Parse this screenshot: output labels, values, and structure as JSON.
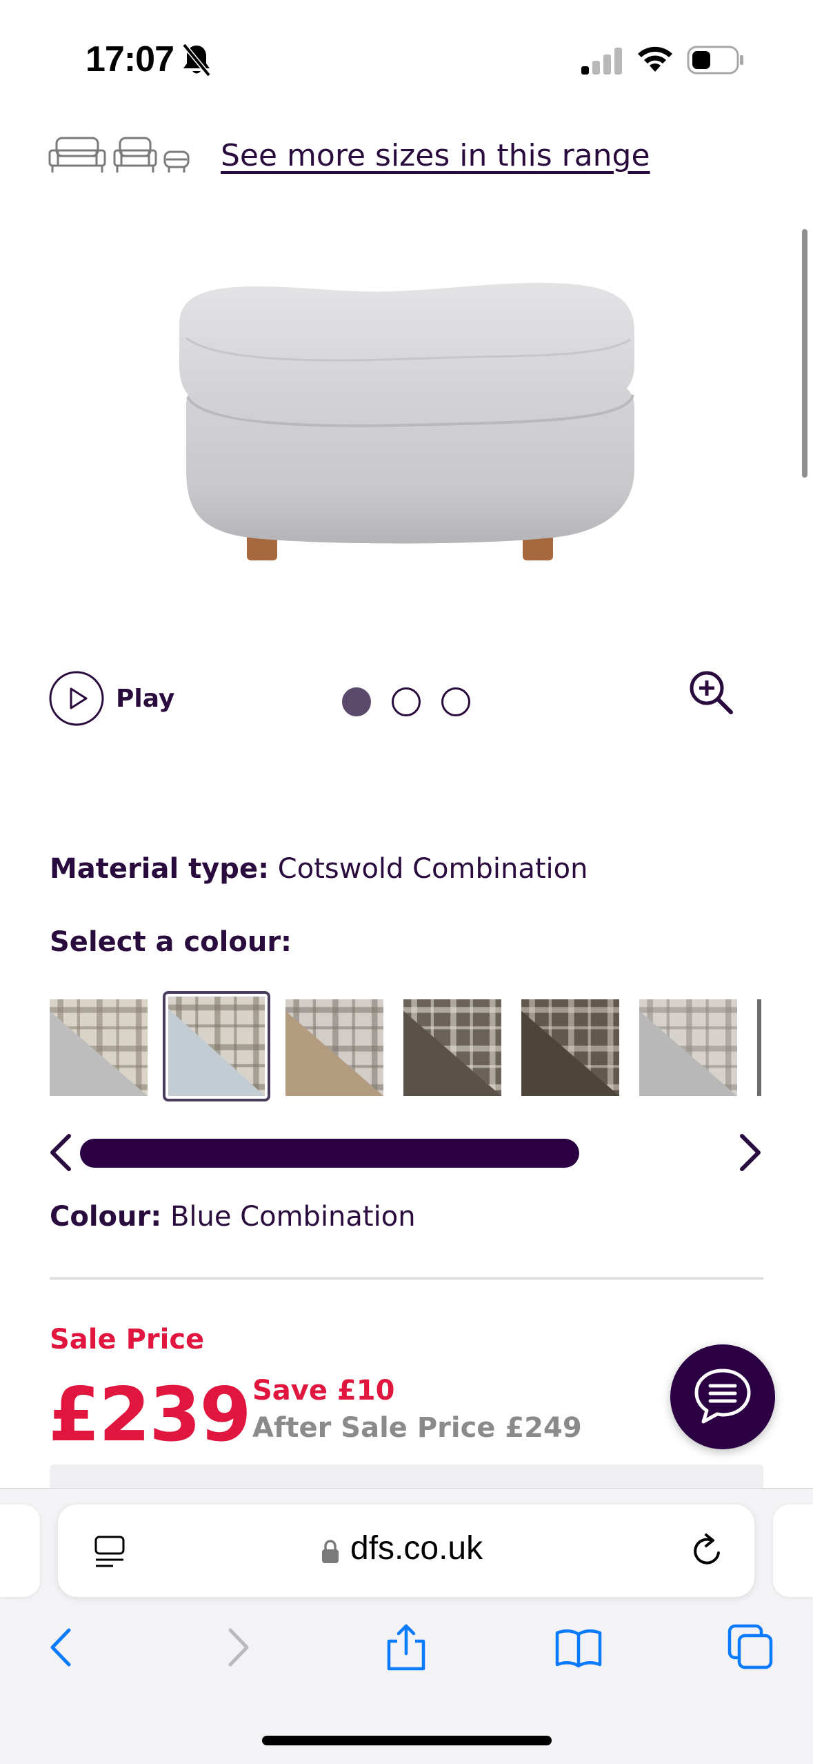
{
  "status_bar": {
    "time": "17:07",
    "icons": [
      "bell-muted-icon",
      "signal-icon",
      "wifi-icon",
      "battery-icon"
    ]
  },
  "sizes": {
    "icons": [
      "sofa-large-icon",
      "sofa-medium-icon",
      "footstool-icon"
    ],
    "link_text": "See more sizes in this range"
  },
  "product": {
    "image": "grey-oval-footstool"
  },
  "media": {
    "play_label": "Play",
    "dots": 3,
    "active_dot": 1
  },
  "material": {
    "label": "Material type:",
    "value": "Cotswold Combination"
  },
  "colour_select": {
    "heading": "Select a colour:",
    "swatches": [
      {
        "name": "grey-check",
        "plain": "#bdbdbd",
        "check_bg": "#d9d3c8",
        "check_line": "#8a7f72"
      },
      {
        "name": "blue-check",
        "plain": "#c3ccd3",
        "check_bg": "#d8d3ca",
        "check_line": "#7e7466",
        "selected": true
      },
      {
        "name": "beige-check",
        "plain": "#b39b80",
        "check_bg": "#d2cdc6",
        "check_line": "#7d7670"
      },
      {
        "name": "dark-brown-check",
        "plain": "#5a5148",
        "check_bg": "#6b6259",
        "check_line": "#e8e2d8"
      },
      {
        "name": "brown-check",
        "plain": "#4d4539",
        "check_bg": "#62584c",
        "check_line": "#d9d1c4"
      },
      {
        "name": "light-grey-check",
        "plain": "#b8b8b8",
        "check_bg": "#d7d2cc",
        "check_line": "#8e8882"
      }
    ],
    "scroll_progress": 0.65
  },
  "selected_colour": {
    "label": "Colour:",
    "value": "Blue Combination"
  },
  "price": {
    "sale_label": "Sale Price",
    "amount": "£239",
    "save": "Save £10",
    "after_sale": "After Sale Price £249"
  },
  "browser": {
    "url": "dfs.co.uk",
    "nav_icons": [
      "back-icon",
      "forward-icon",
      "share-icon",
      "bookmarks-icon",
      "tabs-icon"
    ]
  },
  "colors": {
    "brand_purple": "#2a0042",
    "text_purple": "#2a0b3d",
    "sale_red": "#e0163e",
    "ios_blue": "#0a7aff"
  }
}
